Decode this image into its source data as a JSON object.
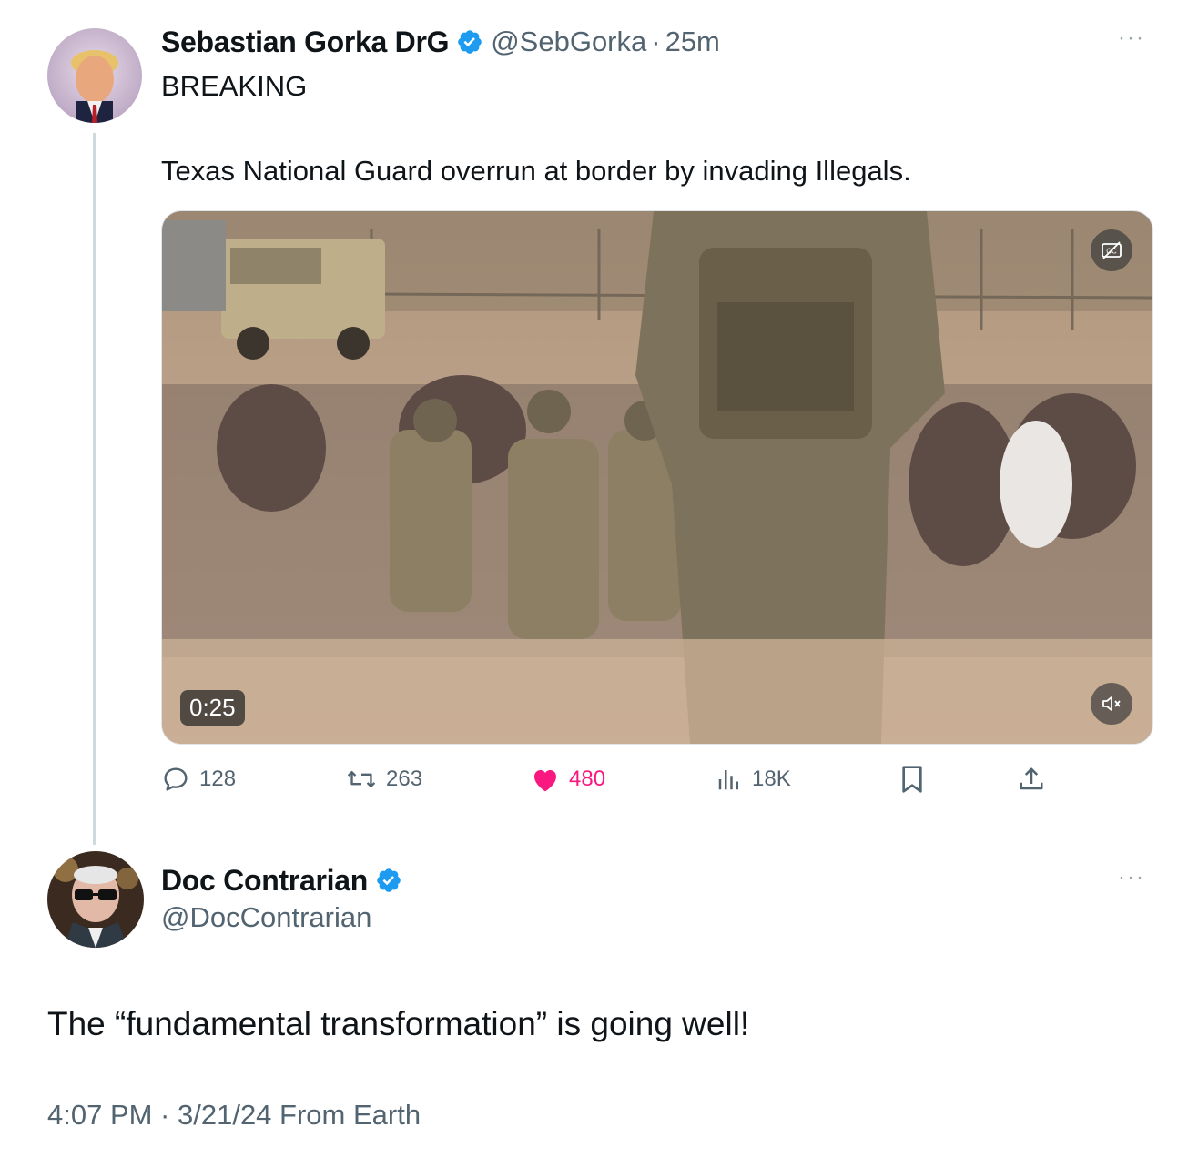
{
  "tweet": {
    "author_name": "Sebastian Gorka DrG",
    "handle": "@SebGorka",
    "separator": "·",
    "time": "25m",
    "more_label": "···",
    "line1": "BREAKING",
    "line2": "Texas National Guard overrun at border by invading Illegals.",
    "video": {
      "duration": "0:25",
      "captions_icon": "cc-icon",
      "mute_icon": "muted-speaker-icon"
    },
    "actions": {
      "replies": "128",
      "retweets": "263",
      "likes": "480",
      "views": "18K"
    },
    "colors": {
      "like": "#f91880",
      "verified": "#1d9bf0"
    }
  },
  "reply": {
    "author_name": "Doc Contrarian",
    "handle": "@DocContrarian",
    "more_label": "···",
    "text": "The “fundamental transformation” is going well!",
    "timestamp": "4:07 PM · 3/21/24 From Earth"
  }
}
